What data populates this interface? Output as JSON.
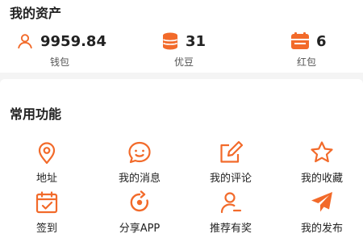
{
  "assets": {
    "title": "我的资产",
    "items": [
      {
        "value": "9959.84",
        "label": "钱包",
        "icon": "user-icon"
      },
      {
        "value": "31",
        "label": "优豆",
        "icon": "coin-stack-icon"
      },
      {
        "value": "6",
        "label": "红包",
        "icon": "red-packet-icon"
      }
    ]
  },
  "functions": {
    "title": "常用功能",
    "items": [
      {
        "label": "地址",
        "icon": "location-pin-icon"
      },
      {
        "label": "我的消息",
        "icon": "message-bubble-icon"
      },
      {
        "label": "我的评论",
        "icon": "edit-comment-icon"
      },
      {
        "label": "我的收藏",
        "icon": "star-icon"
      },
      {
        "label": "签到",
        "icon": "calendar-check-icon"
      },
      {
        "label": "分享APP",
        "icon": "share-icon"
      },
      {
        "label": "推荐有奖",
        "icon": "recommend-user-icon"
      },
      {
        "label": "我的发布",
        "icon": "paper-plane-icon"
      }
    ]
  },
  "colors": {
    "accent": "#f26a2a",
    "text": "#222222",
    "subtext": "#555555"
  }
}
